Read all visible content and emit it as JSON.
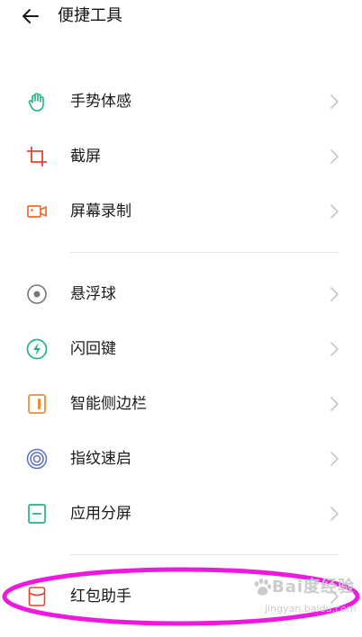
{
  "header": {
    "title": "便捷工具",
    "back_icon": "arrow-left-icon"
  },
  "groups": [
    {
      "items": [
        {
          "label": "手势体感",
          "icon": "hand-gesture-icon",
          "color": "#25b37e"
        },
        {
          "label": "截屏",
          "icon": "crop-icon",
          "color": "#e8432f"
        },
        {
          "label": "屏幕录制",
          "icon": "video-camera-icon",
          "color": "#ef6a2b"
        }
      ]
    },
    {
      "items": [
        {
          "label": "悬浮球",
          "icon": "floating-ball-icon",
          "color": "#777777"
        },
        {
          "label": "闪回键",
          "icon": "lightning-icon",
          "color": "#25b37e"
        },
        {
          "label": "智能侧边栏",
          "icon": "sidebar-icon",
          "color": "#f08a2c"
        },
        {
          "label": "指纹速启",
          "icon": "fingerprint-icon",
          "color": "#5a6fc0"
        },
        {
          "label": "应用分屏",
          "icon": "split-screen-icon",
          "color": "#25b37e"
        }
      ]
    },
    {
      "items": [
        {
          "label": "红包助手",
          "icon": "red-envelope-icon",
          "color": "#e8432f"
        }
      ]
    }
  ],
  "annotation": {
    "color": "#ee18e0"
  },
  "watermark": {
    "main": "Bai度经验",
    "sub": "jingyan.baidu.com"
  }
}
